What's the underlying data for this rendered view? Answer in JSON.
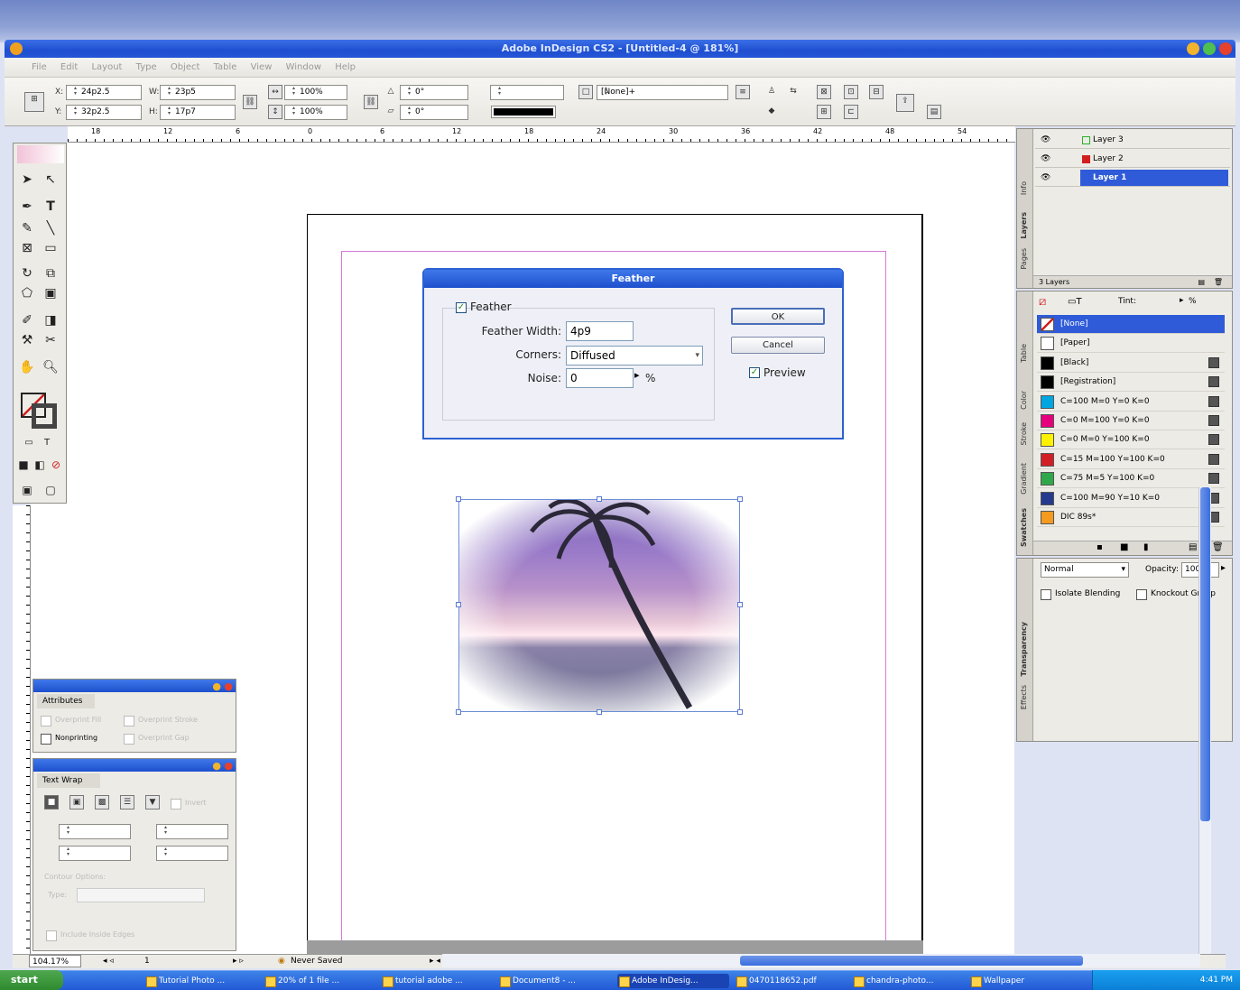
{
  "window": {
    "title": "Adobe InDesign CS2 - [Untitled-4 @ 181%]"
  },
  "menu": [
    "File",
    "Edit",
    "Layout",
    "Type",
    "Object",
    "Table",
    "View",
    "Window",
    "Help"
  ],
  "control": {
    "x": "24p2.5",
    "y": "32p2.5",
    "w": "23p5",
    "h": "17p7",
    "scale_x": "100%",
    "scale_y": "100%",
    "rotate": "0°",
    "shear": "0°",
    "stroke_style": "[None]+",
    "x_label": "X:",
    "y_label": "Y:",
    "w_label": "W:",
    "h_label": "H:"
  },
  "ruler_labels": [
    "18",
    "12",
    "6",
    "0",
    "6",
    "12",
    "18",
    "24",
    "30",
    "36",
    "42",
    "48",
    "54"
  ],
  "dialog": {
    "title": "Feather",
    "feather_checkbox": "Feather",
    "width_label": "Feather Width:",
    "width_value": "4p9",
    "corners_label": "Corners:",
    "corners_value": "Diffused",
    "noise_label": "Noise:",
    "noise_value": "0",
    "noise_unit": "%",
    "ok": "OK",
    "cancel": "Cancel",
    "preview": "Preview"
  },
  "layers": {
    "rows": [
      {
        "name": "Layer 3",
        "color": "#2bb02b"
      },
      {
        "name": "Layer 2",
        "color": "#d21e1e"
      },
      {
        "name": "Layer 1",
        "color": "#2f5bd8"
      }
    ],
    "count": "3 Layers",
    "tabs": [
      "Info",
      "Layers",
      "Pages"
    ]
  },
  "swatches": {
    "tint_label": "Tint:",
    "tint_unit": "%",
    "rows": [
      {
        "name": "[None]",
        "color": "#ffffff"
      },
      {
        "name": "[Paper]",
        "color": "#ffffff"
      },
      {
        "name": "[Black]",
        "color": "#000000"
      },
      {
        "name": "[Registration]",
        "color": "#000000"
      },
      {
        "name": "C=100 M=0 Y=0 K=0",
        "color": "#00a6e0"
      },
      {
        "name": "C=0 M=100 Y=0 K=0",
        "color": "#e6007e"
      },
      {
        "name": "C=0 M=0 Y=100 K=0",
        "color": "#fff200"
      },
      {
        "name": "C=15 M=100 Y=100 K=0",
        "color": "#d21f26"
      },
      {
        "name": "C=75 M=5 Y=100 K=0",
        "color": "#2ea84a"
      },
      {
        "name": "C=100 M=90 Y=10 K=0",
        "color": "#253a8e"
      },
      {
        "name": "DIC 89s*",
        "color": "#f39a1f"
      }
    ],
    "tabs": [
      "Swatches",
      "Gradient",
      "Stroke",
      "Color",
      "Table"
    ]
  },
  "transparency": {
    "mode": "Normal",
    "opacity_label": "Opacity:",
    "opacity_value": "100%",
    "isolate": "Isolate Blending",
    "knockout": "Knockout Group",
    "tabs": [
      "Transparency",
      "Effects"
    ]
  },
  "attributes": {
    "title": "Attributes",
    "nonprinting": "Nonprinting",
    "overprint_fill": "Overprint Fill",
    "overprint_stroke": "Overprint Stroke",
    "overprint_gap": "Overprint Gap"
  },
  "text_wrap": {
    "title": "Text Wrap",
    "invert": "Invert",
    "contour_options": "Contour Options:",
    "type_label": "Type:",
    "include_inside": "Include Inside Edges"
  },
  "status": {
    "zoom": "104.17%",
    "page": "1",
    "saved": "Never Saved"
  },
  "taskbar": {
    "start": "start",
    "items": [
      "Tutorial Photo ...",
      "20% of 1 file ...",
      "tutorial adobe ...",
      "Document8 - ...",
      "Adobe InDesig...",
      "0470118652.pdf",
      "chandra-photo...",
      "Wallpaper"
    ],
    "clock": "4:41 PM"
  }
}
